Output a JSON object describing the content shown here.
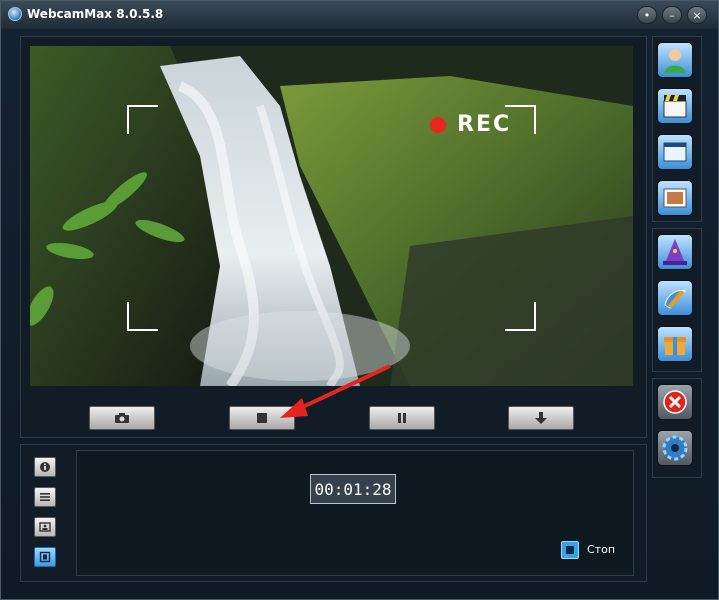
{
  "window": {
    "title": "WebcamMax  8.0.5.8",
    "controls": [
      "minimize",
      "restore",
      "close"
    ]
  },
  "preview": {
    "overlay_label": "REC",
    "record_dot_color": "#e8261d"
  },
  "toolbar": {
    "buttons": [
      "camera-icon",
      "stop-icon",
      "pause-icon",
      "download-icon"
    ]
  },
  "sidebar": {
    "buttons": [
      "user-icon",
      "movie-clapper-icon",
      "window-icon",
      "image-frame-icon",
      "wizard-hat-icon",
      "paint-pen-icon",
      "gift-box-icon",
      "close-red-icon",
      "gear-icon"
    ]
  },
  "left_tabs": [
    "info-icon",
    "list-icon",
    "picture-icon",
    "film-icon"
  ],
  "recording": {
    "timer": "00:01:28",
    "status_label": "Стоп"
  }
}
